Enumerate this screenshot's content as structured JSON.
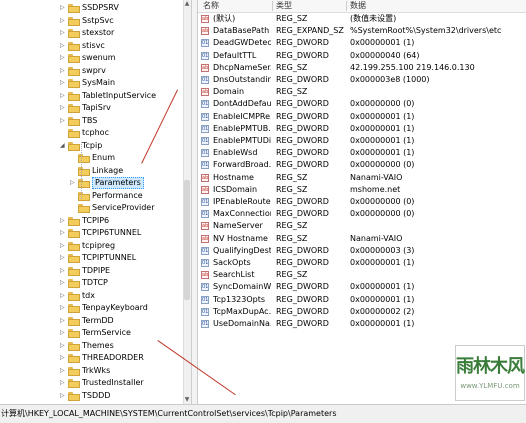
{
  "tree": {
    "items": [
      {
        "label": "SSDPSRV",
        "expand": "▷",
        "indent": 0
      },
      {
        "label": "SstpSvc",
        "expand": "▷",
        "indent": 0
      },
      {
        "label": "stexstor",
        "expand": "▷",
        "indent": 0
      },
      {
        "label": "stisvc",
        "expand": "▷",
        "indent": 0
      },
      {
        "label": "swenum",
        "expand": "▷",
        "indent": 0
      },
      {
        "label": "swprv",
        "expand": "▷",
        "indent": 0
      },
      {
        "label": "SysMain",
        "expand": "▷",
        "indent": 0
      },
      {
        "label": "TabletInputService",
        "expand": "▷",
        "indent": 0
      },
      {
        "label": "TapiSrv",
        "expand": "▷",
        "indent": 0
      },
      {
        "label": "TBS",
        "expand": "▷",
        "indent": 0
      },
      {
        "label": "tcphoc",
        "expand": "",
        "indent": 0
      },
      {
        "label": "Tcpip",
        "expand": "◢",
        "indent": 0
      },
      {
        "label": "Enum",
        "expand": "",
        "indent": 1
      },
      {
        "label": "Linkage",
        "expand": "",
        "indent": 1
      },
      {
        "label": "Parameters",
        "expand": "▷",
        "indent": 1,
        "selected": true
      },
      {
        "label": "Performance",
        "expand": "",
        "indent": 1
      },
      {
        "label": "ServiceProvider",
        "expand": "",
        "indent": 1
      },
      {
        "label": "TCPIP6",
        "expand": "▷",
        "indent": 0
      },
      {
        "label": "TCPIP6TUNNEL",
        "expand": "▷",
        "indent": 0
      },
      {
        "label": "tcpipreg",
        "expand": "▷",
        "indent": 0
      },
      {
        "label": "TCPIPTUNNEL",
        "expand": "▷",
        "indent": 0
      },
      {
        "label": "TDPIPE",
        "expand": "▷",
        "indent": 0
      },
      {
        "label": "TDTCP",
        "expand": "▷",
        "indent": 0
      },
      {
        "label": "tdx",
        "expand": "▷",
        "indent": 0
      },
      {
        "label": "TenpayKeyboard",
        "expand": "▷",
        "indent": 0
      },
      {
        "label": "TermDD",
        "expand": "▷",
        "indent": 0
      },
      {
        "label": "TermService",
        "expand": "▷",
        "indent": 0
      },
      {
        "label": "Themes",
        "expand": "▷",
        "indent": 0
      },
      {
        "label": "THREADORDER",
        "expand": "▷",
        "indent": 0
      },
      {
        "label": "TrkWks",
        "expand": "▷",
        "indent": 0
      },
      {
        "label": "TrustedInstaller",
        "expand": "▷",
        "indent": 0
      },
      {
        "label": "TSDDD",
        "expand": "▷",
        "indent": 0
      }
    ]
  },
  "values": {
    "columns": {
      "name": "名称",
      "type": "类型",
      "data": "数据"
    },
    "rows": [
      {
        "icon": "ab",
        "name": "(默认)",
        "type": "REG_SZ",
        "data": "(数值未设置)"
      },
      {
        "icon": "ab",
        "name": "DataBasePath",
        "type": "REG_EXPAND_SZ",
        "data": "%SystemRoot%\\System32\\drivers\\etc"
      },
      {
        "icon": "dw",
        "name": "DeadGWDetec...",
        "type": "REG_DWORD",
        "data": "0x00000001 (1)"
      },
      {
        "icon": "dw",
        "name": "DefaultTTL",
        "type": "REG_DWORD",
        "data": "0x00000040 (64)"
      },
      {
        "icon": "ab",
        "name": "DhcpNameSer...",
        "type": "REG_SZ",
        "data": "42.199.255.100 219.146.0.130"
      },
      {
        "icon": "dw",
        "name": "DnsOutstandin...",
        "type": "REG_DWORD",
        "data": "0x000003e8 (1000)"
      },
      {
        "icon": "ab",
        "name": "Domain",
        "type": "REG_SZ",
        "data": ""
      },
      {
        "icon": "dw",
        "name": "DontAddDefau...",
        "type": "REG_DWORD",
        "data": "0x00000000 (0)"
      },
      {
        "icon": "dw",
        "name": "EnableICMPRe...",
        "type": "REG_DWORD",
        "data": "0x00000001 (1)"
      },
      {
        "icon": "dw",
        "name": "EnablePMTUB...",
        "type": "REG_DWORD",
        "data": "0x00000001 (1)"
      },
      {
        "icon": "dw",
        "name": "EnablePMTUDi...",
        "type": "REG_DWORD",
        "data": "0x00000001 (1)"
      },
      {
        "icon": "dw",
        "name": "EnableWsd",
        "type": "REG_DWORD",
        "data": "0x00000001 (1)"
      },
      {
        "icon": "dw",
        "name": "ForwardBroad...",
        "type": "REG_DWORD",
        "data": "0x00000000 (0)"
      },
      {
        "icon": "ab",
        "name": "Hostname",
        "type": "REG_SZ",
        "data": "Nanami-VAIO"
      },
      {
        "icon": "ab",
        "name": "ICSDomain",
        "type": "REG_SZ",
        "data": "mshome.net"
      },
      {
        "icon": "dw",
        "name": "IPEnableRouter",
        "type": "REG_DWORD",
        "data": "0x00000000 (0)"
      },
      {
        "icon": "dw",
        "name": "MaxConnection...",
        "type": "REG_DWORD",
        "data": "0x00000000 (0)"
      },
      {
        "icon": "ab",
        "name": "NameServer",
        "type": "REG_SZ",
        "data": ""
      },
      {
        "icon": "ab",
        "name": "NV Hostname",
        "type": "REG_SZ",
        "data": "Nanami-VAIO"
      },
      {
        "icon": "dw",
        "name": "QualifyingDesti...",
        "type": "REG_DWORD",
        "data": "0x00000003 (3)"
      },
      {
        "icon": "dw",
        "name": "SackOpts",
        "type": "REG_DWORD",
        "data": "0x00000001 (1)"
      },
      {
        "icon": "ab",
        "name": "SearchList",
        "type": "REG_SZ",
        "data": ""
      },
      {
        "icon": "dw",
        "name": "SyncDomainWi...",
        "type": "REG_DWORD",
        "data": "0x00000001 (1)"
      },
      {
        "icon": "dw",
        "name": "Tcp1323Opts",
        "type": "REG_DWORD",
        "data": "0x00000001 (1)"
      },
      {
        "icon": "dw",
        "name": "TcpMaxDupAc...",
        "type": "REG_DWORD",
        "data": "0x00000002 (2)"
      },
      {
        "icon": "dw",
        "name": "UseDomainNa...",
        "type": "REG_DWORD",
        "data": "0x00000001 (1)"
      }
    ]
  },
  "statusbar": {
    "path": "计算机\\HKEY_LOCAL_MACHINE\\SYSTEM\\CurrentControlSet\\services\\Tcpip\\Parameters"
  },
  "watermark": {
    "title": "雨林木风",
    "url": "www.YLMFU.com"
  },
  "colors": {
    "folder": "#f2cd5c",
    "selection": "#cde8ff",
    "annotation": "#c0392b"
  }
}
